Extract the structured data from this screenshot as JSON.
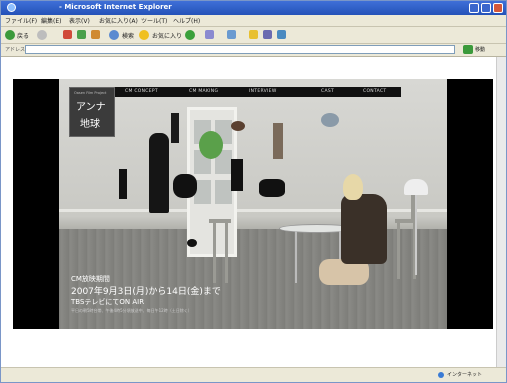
{
  "window": {
    "title": "- Microsoft Internet Explorer"
  },
  "menu": {
    "items": [
      "ファイル(F)",
      "編集(E)",
      "表示(V)",
      "お気に入り(A)",
      "ツール(T)",
      "ヘルプ(H)"
    ]
  },
  "toolbar": {
    "back_label": "戻る",
    "search_label": "検索",
    "favorites_label": "お気に入り"
  },
  "address": {
    "label": "アドレス(D)",
    "value": "",
    "go_label": "移動"
  },
  "site": {
    "logo_small": "Oasen Film Project",
    "logo_line1": "アンナ",
    "logo_line2": "地球",
    "nav": [
      "CM CONCEPT",
      "CM MAKING",
      "INTERVIEW",
      "CAST",
      "CONTACT"
    ],
    "caption": {
      "label": "CM放映期間",
      "dates": "2007年9月3日(月)から14日(金)まで",
      "channel": "TBSテレビにてON AIR",
      "note": "平日の朝5時台帯、午後4時5分頃放送中、毎日午12時（土日除く）"
    }
  },
  "status": {
    "zone": "インターネット"
  }
}
